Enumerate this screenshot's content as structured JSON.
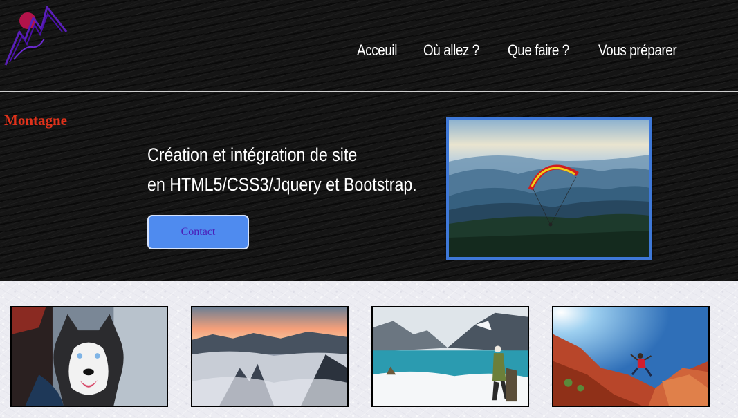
{
  "header": {
    "logo_icon": "mountain-sun-logo",
    "nav": [
      {
        "label": "Acceuil"
      },
      {
        "label": "Où allez ?"
      },
      {
        "label": "Que faire ?"
      },
      {
        "label": "Vous préparer"
      }
    ]
  },
  "hero": {
    "brand": "Montagne",
    "tagline_line1": "Création et intégration de site",
    "tagline_line2": "en HTML5/CSS3/Jquery et Bootstrap.",
    "contact_label": "Contact",
    "photo_subject": "paraglider-over-misty-mountains"
  },
  "gallery": {
    "items": [
      {
        "subject": "husky-dog"
      },
      {
        "subject": "sunset-sea-of-clouds"
      },
      {
        "subject": "hiker-by-glacier-lake"
      },
      {
        "subject": "climber-jumping-red-rocks"
      }
    ]
  },
  "colors": {
    "brand_red": "#e0321b",
    "button_blue": "#4f8bef",
    "photo_border": "#3e78d8",
    "logo_purple": "#5a1fb8",
    "logo_sun": "#b3134a"
  }
}
